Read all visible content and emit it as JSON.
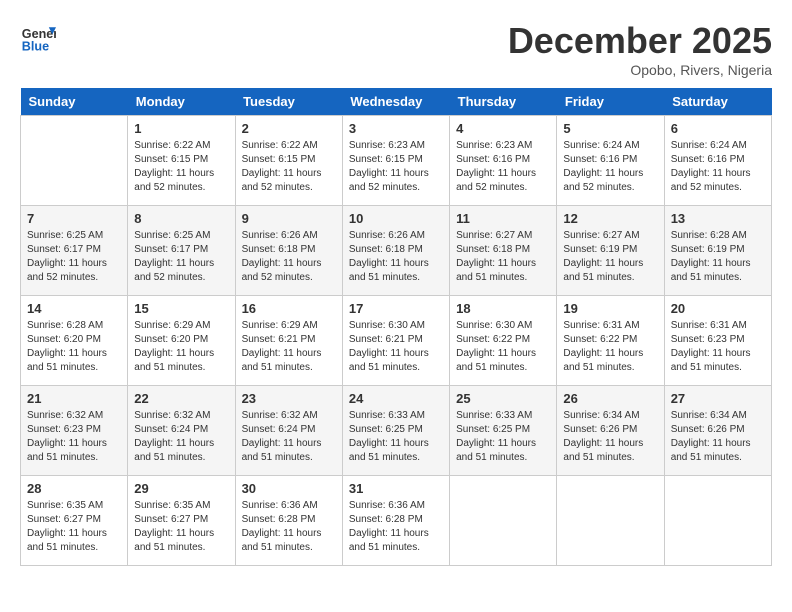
{
  "header": {
    "logo_line1": "General",
    "logo_line2": "Blue",
    "month_title": "December 2025",
    "location": "Opobo, Rivers, Nigeria"
  },
  "calendar": {
    "days_of_week": [
      "Sunday",
      "Monday",
      "Tuesday",
      "Wednesday",
      "Thursday",
      "Friday",
      "Saturday"
    ],
    "weeks": [
      [
        {
          "day": "",
          "info": ""
        },
        {
          "day": "1",
          "info": "Sunrise: 6:22 AM\nSunset: 6:15 PM\nDaylight: 11 hours\nand 52 minutes."
        },
        {
          "day": "2",
          "info": "Sunrise: 6:22 AM\nSunset: 6:15 PM\nDaylight: 11 hours\nand 52 minutes."
        },
        {
          "day": "3",
          "info": "Sunrise: 6:23 AM\nSunset: 6:15 PM\nDaylight: 11 hours\nand 52 minutes."
        },
        {
          "day": "4",
          "info": "Sunrise: 6:23 AM\nSunset: 6:16 PM\nDaylight: 11 hours\nand 52 minutes."
        },
        {
          "day": "5",
          "info": "Sunrise: 6:24 AM\nSunset: 6:16 PM\nDaylight: 11 hours\nand 52 minutes."
        },
        {
          "day": "6",
          "info": "Sunrise: 6:24 AM\nSunset: 6:16 PM\nDaylight: 11 hours\nand 52 minutes."
        }
      ],
      [
        {
          "day": "7",
          "info": "Sunrise: 6:25 AM\nSunset: 6:17 PM\nDaylight: 11 hours\nand 52 minutes."
        },
        {
          "day": "8",
          "info": "Sunrise: 6:25 AM\nSunset: 6:17 PM\nDaylight: 11 hours\nand 52 minutes."
        },
        {
          "day": "9",
          "info": "Sunrise: 6:26 AM\nSunset: 6:18 PM\nDaylight: 11 hours\nand 52 minutes."
        },
        {
          "day": "10",
          "info": "Sunrise: 6:26 AM\nSunset: 6:18 PM\nDaylight: 11 hours\nand 51 minutes."
        },
        {
          "day": "11",
          "info": "Sunrise: 6:27 AM\nSunset: 6:18 PM\nDaylight: 11 hours\nand 51 minutes."
        },
        {
          "day": "12",
          "info": "Sunrise: 6:27 AM\nSunset: 6:19 PM\nDaylight: 11 hours\nand 51 minutes."
        },
        {
          "day": "13",
          "info": "Sunrise: 6:28 AM\nSunset: 6:19 PM\nDaylight: 11 hours\nand 51 minutes."
        }
      ],
      [
        {
          "day": "14",
          "info": "Sunrise: 6:28 AM\nSunset: 6:20 PM\nDaylight: 11 hours\nand 51 minutes."
        },
        {
          "day": "15",
          "info": "Sunrise: 6:29 AM\nSunset: 6:20 PM\nDaylight: 11 hours\nand 51 minutes."
        },
        {
          "day": "16",
          "info": "Sunrise: 6:29 AM\nSunset: 6:21 PM\nDaylight: 11 hours\nand 51 minutes."
        },
        {
          "day": "17",
          "info": "Sunrise: 6:30 AM\nSunset: 6:21 PM\nDaylight: 11 hours\nand 51 minutes."
        },
        {
          "day": "18",
          "info": "Sunrise: 6:30 AM\nSunset: 6:22 PM\nDaylight: 11 hours\nand 51 minutes."
        },
        {
          "day": "19",
          "info": "Sunrise: 6:31 AM\nSunset: 6:22 PM\nDaylight: 11 hours\nand 51 minutes."
        },
        {
          "day": "20",
          "info": "Sunrise: 6:31 AM\nSunset: 6:23 PM\nDaylight: 11 hours\nand 51 minutes."
        }
      ],
      [
        {
          "day": "21",
          "info": "Sunrise: 6:32 AM\nSunset: 6:23 PM\nDaylight: 11 hours\nand 51 minutes."
        },
        {
          "day": "22",
          "info": "Sunrise: 6:32 AM\nSunset: 6:24 PM\nDaylight: 11 hours\nand 51 minutes."
        },
        {
          "day": "23",
          "info": "Sunrise: 6:32 AM\nSunset: 6:24 PM\nDaylight: 11 hours\nand 51 minutes."
        },
        {
          "day": "24",
          "info": "Sunrise: 6:33 AM\nSunset: 6:25 PM\nDaylight: 11 hours\nand 51 minutes."
        },
        {
          "day": "25",
          "info": "Sunrise: 6:33 AM\nSunset: 6:25 PM\nDaylight: 11 hours\nand 51 minutes."
        },
        {
          "day": "26",
          "info": "Sunrise: 6:34 AM\nSunset: 6:26 PM\nDaylight: 11 hours\nand 51 minutes."
        },
        {
          "day": "27",
          "info": "Sunrise: 6:34 AM\nSunset: 6:26 PM\nDaylight: 11 hours\nand 51 minutes."
        }
      ],
      [
        {
          "day": "28",
          "info": "Sunrise: 6:35 AM\nSunset: 6:27 PM\nDaylight: 11 hours\nand 51 minutes."
        },
        {
          "day": "29",
          "info": "Sunrise: 6:35 AM\nSunset: 6:27 PM\nDaylight: 11 hours\nand 51 minutes."
        },
        {
          "day": "30",
          "info": "Sunrise: 6:36 AM\nSunset: 6:28 PM\nDaylight: 11 hours\nand 51 minutes."
        },
        {
          "day": "31",
          "info": "Sunrise: 6:36 AM\nSunset: 6:28 PM\nDaylight: 11 hours\nand 51 minutes."
        },
        {
          "day": "",
          "info": ""
        },
        {
          "day": "",
          "info": ""
        },
        {
          "day": "",
          "info": ""
        }
      ]
    ]
  }
}
